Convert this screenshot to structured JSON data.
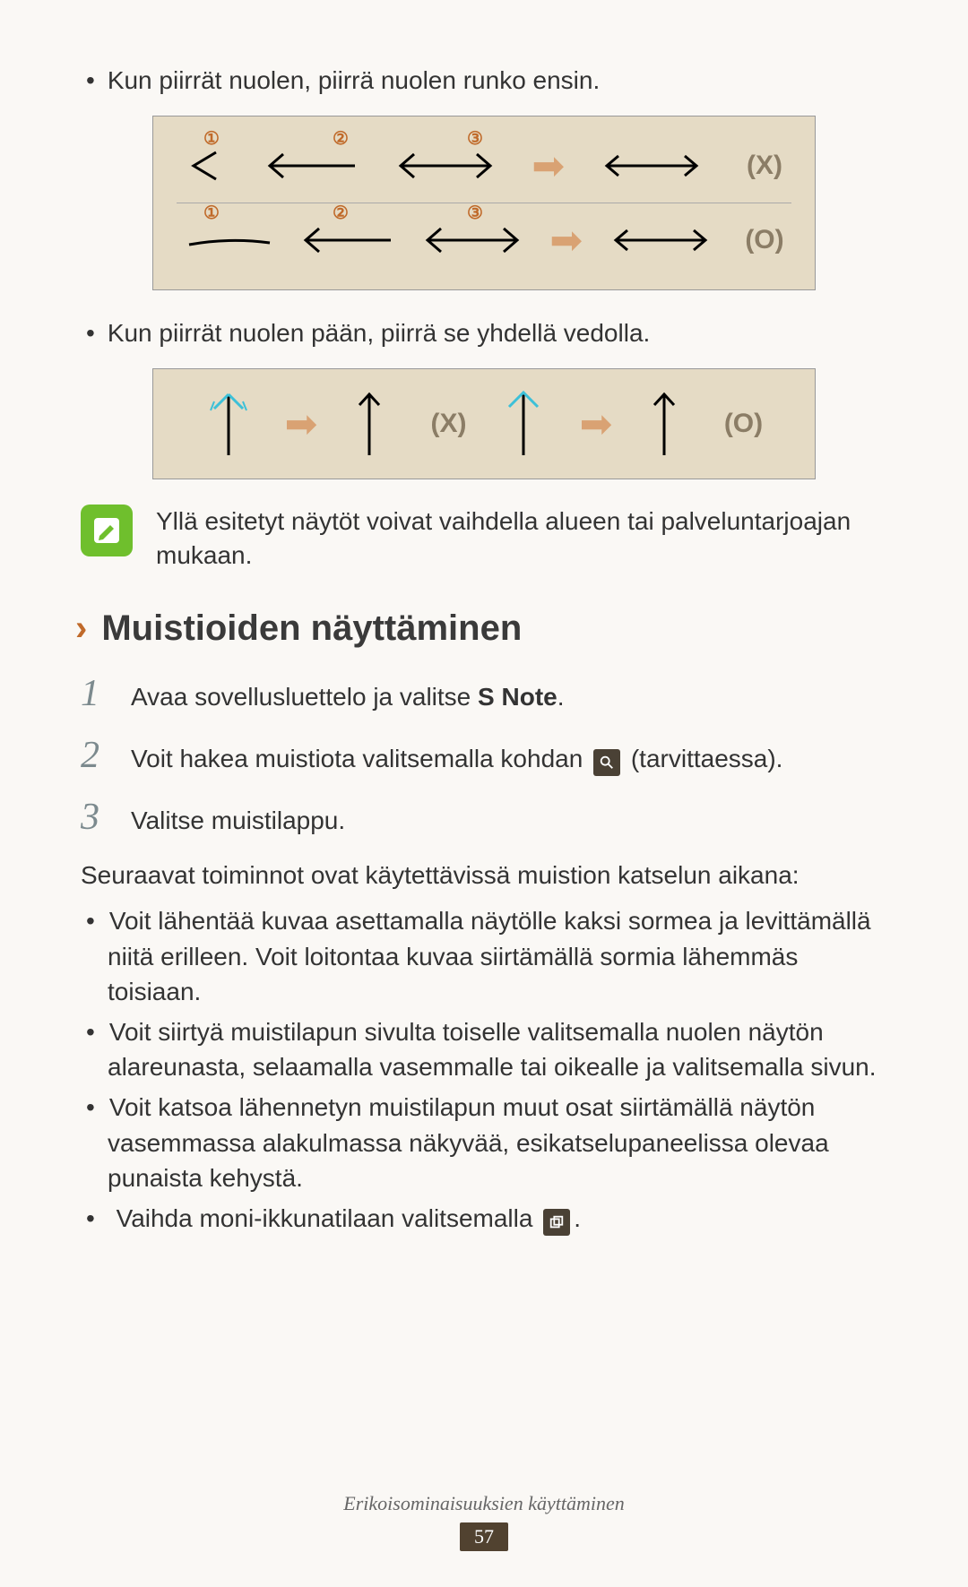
{
  "bullets": {
    "b1": "Kun piirrät nuolen, piirrä nuolen runko ensin.",
    "b2": "Kun piirrät nuolen pään, piirrä se yhdellä vedolla."
  },
  "diagram1": {
    "nums": {
      "n1": "①",
      "n2": "②",
      "n3": "③"
    },
    "labels": {
      "wrong": "(X)",
      "right": "(O)"
    }
  },
  "diagram2": {
    "labels": {
      "wrong": "(X)",
      "right": "(O)"
    }
  },
  "note": "Yllä esitetyt näytöt voivat vaihdella alueen tai palveluntarjoajan mukaan.",
  "section": {
    "title": "Muistioiden näyttäminen"
  },
  "steps": {
    "s1_pre": "Avaa sovellusluettelo ja valitse ",
    "s1_bold": "S Note",
    "s1_post": ".",
    "s2_pre": "Voit hakea muistiota valitsemalla kohdan ",
    "s2_post": " (tarvittaessa).",
    "s3": "Valitse muistilappu."
  },
  "body": "Seuraavat toiminnot ovat käytettävissä muistion katselun aikana:",
  "subbullets": {
    "sb1": "Voit lähentää kuvaa asettamalla näytölle kaksi sormea ja levittämällä niitä erilleen. Voit loitontaa kuvaa siirtämällä sormia lähemmäs toisiaan.",
    "sb2": "Voit siirtyä muistilapun sivulta toiselle valitsemalla nuolen näytön alareunasta, selaamalla vasemmalle tai oikealle ja valitsemalla sivun.",
    "sb3": "Voit katsoa lähennetyn muistilapun muut osat siirtämällä näytön vasemmassa alakulmassa näkyvää, esikatselupaneelissa olevaa punaista kehystä.",
    "sb4_pre": "Vaihda moni-ikkunatilaan valitsemalla ",
    "sb4_post": "."
  },
  "footer": {
    "text": "Erikoisominaisuuksien käyttäminen",
    "page": "57"
  },
  "step_numbers": {
    "n1": "1",
    "n2": "2",
    "n3": "3"
  }
}
